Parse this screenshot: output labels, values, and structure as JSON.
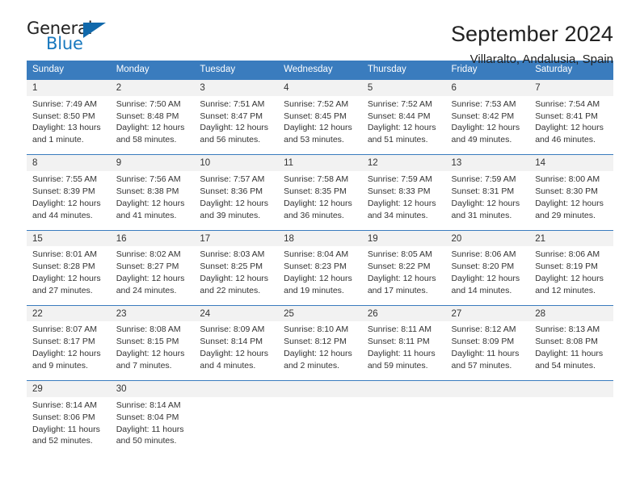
{
  "logo": {
    "word_one": "General",
    "word_two": "Blue",
    "triangle_icon": "triangle-icon",
    "color_dark": "#222222",
    "color_blue": "#1878be"
  },
  "header": {
    "title": "September 2024",
    "subtitle": "Villaralto, Andalusia, Spain"
  },
  "calendar": {
    "header_bg": "#3a7cbe",
    "daynum_bg": "#f2f2f2",
    "weekdays": [
      "Sunday",
      "Monday",
      "Tuesday",
      "Wednesday",
      "Thursday",
      "Friday",
      "Saturday"
    ],
    "weeks": [
      [
        {
          "day": "1",
          "sunrise": "Sunrise: 7:49 AM",
          "sunset": "Sunset: 8:50 PM",
          "daylight1": "Daylight: 13 hours",
          "daylight2": "and 1 minute."
        },
        {
          "day": "2",
          "sunrise": "Sunrise: 7:50 AM",
          "sunset": "Sunset: 8:48 PM",
          "daylight1": "Daylight: 12 hours",
          "daylight2": "and 58 minutes."
        },
        {
          "day": "3",
          "sunrise": "Sunrise: 7:51 AM",
          "sunset": "Sunset: 8:47 PM",
          "daylight1": "Daylight: 12 hours",
          "daylight2": "and 56 minutes."
        },
        {
          "day": "4",
          "sunrise": "Sunrise: 7:52 AM",
          "sunset": "Sunset: 8:45 PM",
          "daylight1": "Daylight: 12 hours",
          "daylight2": "and 53 minutes."
        },
        {
          "day": "5",
          "sunrise": "Sunrise: 7:52 AM",
          "sunset": "Sunset: 8:44 PM",
          "daylight1": "Daylight: 12 hours",
          "daylight2": "and 51 minutes."
        },
        {
          "day": "6",
          "sunrise": "Sunrise: 7:53 AM",
          "sunset": "Sunset: 8:42 PM",
          "daylight1": "Daylight: 12 hours",
          "daylight2": "and 49 minutes."
        },
        {
          "day": "7",
          "sunrise": "Sunrise: 7:54 AM",
          "sunset": "Sunset: 8:41 PM",
          "daylight1": "Daylight: 12 hours",
          "daylight2": "and 46 minutes."
        }
      ],
      [
        {
          "day": "8",
          "sunrise": "Sunrise: 7:55 AM",
          "sunset": "Sunset: 8:39 PM",
          "daylight1": "Daylight: 12 hours",
          "daylight2": "and 44 minutes."
        },
        {
          "day": "9",
          "sunrise": "Sunrise: 7:56 AM",
          "sunset": "Sunset: 8:38 PM",
          "daylight1": "Daylight: 12 hours",
          "daylight2": "and 41 minutes."
        },
        {
          "day": "10",
          "sunrise": "Sunrise: 7:57 AM",
          "sunset": "Sunset: 8:36 PM",
          "daylight1": "Daylight: 12 hours",
          "daylight2": "and 39 minutes."
        },
        {
          "day": "11",
          "sunrise": "Sunrise: 7:58 AM",
          "sunset": "Sunset: 8:35 PM",
          "daylight1": "Daylight: 12 hours",
          "daylight2": "and 36 minutes."
        },
        {
          "day": "12",
          "sunrise": "Sunrise: 7:59 AM",
          "sunset": "Sunset: 8:33 PM",
          "daylight1": "Daylight: 12 hours",
          "daylight2": "and 34 minutes."
        },
        {
          "day": "13",
          "sunrise": "Sunrise: 7:59 AM",
          "sunset": "Sunset: 8:31 PM",
          "daylight1": "Daylight: 12 hours",
          "daylight2": "and 31 minutes."
        },
        {
          "day": "14",
          "sunrise": "Sunrise: 8:00 AM",
          "sunset": "Sunset: 8:30 PM",
          "daylight1": "Daylight: 12 hours",
          "daylight2": "and 29 minutes."
        }
      ],
      [
        {
          "day": "15",
          "sunrise": "Sunrise: 8:01 AM",
          "sunset": "Sunset: 8:28 PM",
          "daylight1": "Daylight: 12 hours",
          "daylight2": "and 27 minutes."
        },
        {
          "day": "16",
          "sunrise": "Sunrise: 8:02 AM",
          "sunset": "Sunset: 8:27 PM",
          "daylight1": "Daylight: 12 hours",
          "daylight2": "and 24 minutes."
        },
        {
          "day": "17",
          "sunrise": "Sunrise: 8:03 AM",
          "sunset": "Sunset: 8:25 PM",
          "daylight1": "Daylight: 12 hours",
          "daylight2": "and 22 minutes."
        },
        {
          "day": "18",
          "sunrise": "Sunrise: 8:04 AM",
          "sunset": "Sunset: 8:23 PM",
          "daylight1": "Daylight: 12 hours",
          "daylight2": "and 19 minutes."
        },
        {
          "day": "19",
          "sunrise": "Sunrise: 8:05 AM",
          "sunset": "Sunset: 8:22 PM",
          "daylight1": "Daylight: 12 hours",
          "daylight2": "and 17 minutes."
        },
        {
          "day": "20",
          "sunrise": "Sunrise: 8:06 AM",
          "sunset": "Sunset: 8:20 PM",
          "daylight1": "Daylight: 12 hours",
          "daylight2": "and 14 minutes."
        },
        {
          "day": "21",
          "sunrise": "Sunrise: 8:06 AM",
          "sunset": "Sunset: 8:19 PM",
          "daylight1": "Daylight: 12 hours",
          "daylight2": "and 12 minutes."
        }
      ],
      [
        {
          "day": "22",
          "sunrise": "Sunrise: 8:07 AM",
          "sunset": "Sunset: 8:17 PM",
          "daylight1": "Daylight: 12 hours",
          "daylight2": "and 9 minutes."
        },
        {
          "day": "23",
          "sunrise": "Sunrise: 8:08 AM",
          "sunset": "Sunset: 8:15 PM",
          "daylight1": "Daylight: 12 hours",
          "daylight2": "and 7 minutes."
        },
        {
          "day": "24",
          "sunrise": "Sunrise: 8:09 AM",
          "sunset": "Sunset: 8:14 PM",
          "daylight1": "Daylight: 12 hours",
          "daylight2": "and 4 minutes."
        },
        {
          "day": "25",
          "sunrise": "Sunrise: 8:10 AM",
          "sunset": "Sunset: 8:12 PM",
          "daylight1": "Daylight: 12 hours",
          "daylight2": "and 2 minutes."
        },
        {
          "day": "26",
          "sunrise": "Sunrise: 8:11 AM",
          "sunset": "Sunset: 8:11 PM",
          "daylight1": "Daylight: 11 hours",
          "daylight2": "and 59 minutes."
        },
        {
          "day": "27",
          "sunrise": "Sunrise: 8:12 AM",
          "sunset": "Sunset: 8:09 PM",
          "daylight1": "Daylight: 11 hours",
          "daylight2": "and 57 minutes."
        },
        {
          "day": "28",
          "sunrise": "Sunrise: 8:13 AM",
          "sunset": "Sunset: 8:08 PM",
          "daylight1": "Daylight: 11 hours",
          "daylight2": "and 54 minutes."
        }
      ],
      [
        {
          "day": "29",
          "sunrise": "Sunrise: 8:14 AM",
          "sunset": "Sunset: 8:06 PM",
          "daylight1": "Daylight: 11 hours",
          "daylight2": "and 52 minutes."
        },
        {
          "day": "30",
          "sunrise": "Sunrise: 8:14 AM",
          "sunset": "Sunset: 8:04 PM",
          "daylight1": "Daylight: 11 hours",
          "daylight2": "and 50 minutes."
        },
        {
          "day": "",
          "sunrise": "",
          "sunset": "",
          "daylight1": "",
          "daylight2": ""
        },
        {
          "day": "",
          "sunrise": "",
          "sunset": "",
          "daylight1": "",
          "daylight2": ""
        },
        {
          "day": "",
          "sunrise": "",
          "sunset": "",
          "daylight1": "",
          "daylight2": ""
        },
        {
          "day": "",
          "sunrise": "",
          "sunset": "",
          "daylight1": "",
          "daylight2": ""
        },
        {
          "day": "",
          "sunrise": "",
          "sunset": "",
          "daylight1": "",
          "daylight2": ""
        }
      ]
    ]
  }
}
